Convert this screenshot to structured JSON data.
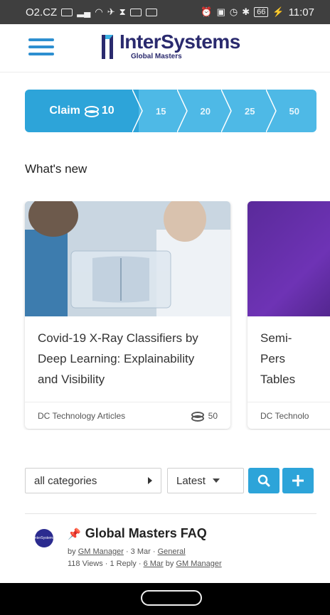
{
  "status_bar": {
    "carrier": "O2.CZ",
    "time": "11:07",
    "battery": "66"
  },
  "header": {
    "logo_name": "InterSystems",
    "logo_sub": "Global Masters"
  },
  "claim_stepper": {
    "claim_label": "Claim",
    "claim_points": "10",
    "steps": [
      "15",
      "20",
      "25",
      "50"
    ]
  },
  "whats_new": {
    "title": "What's new",
    "cards": [
      {
        "title": "Covid-19 X-Ray Classifiers by Deep Learning: Explainability and Visibility",
        "category": "DC Technology Articles",
        "points": "50"
      },
      {
        "title": "Semi-Pers Tables",
        "category": "DC Technolo"
      }
    ]
  },
  "filters": {
    "category_value": "all categories",
    "sort_value": "Latest",
    "search_icon": "search-icon",
    "add_icon": "plus-icon"
  },
  "topic": {
    "avatar_text": "InterSystems",
    "title": "Global Masters FAQ",
    "by_prefix": "by",
    "author": "GM Manager",
    "date": "· 3 Mar ·",
    "category": "General",
    "stats": "118 Views · 1 Reply ·",
    "last_date": "6 Mar",
    "last_by_prefix": "by",
    "last_author": "GM Manager"
  },
  "colors": {
    "accent": "#2da4d9",
    "brand_dark": "#2a2a6e"
  }
}
